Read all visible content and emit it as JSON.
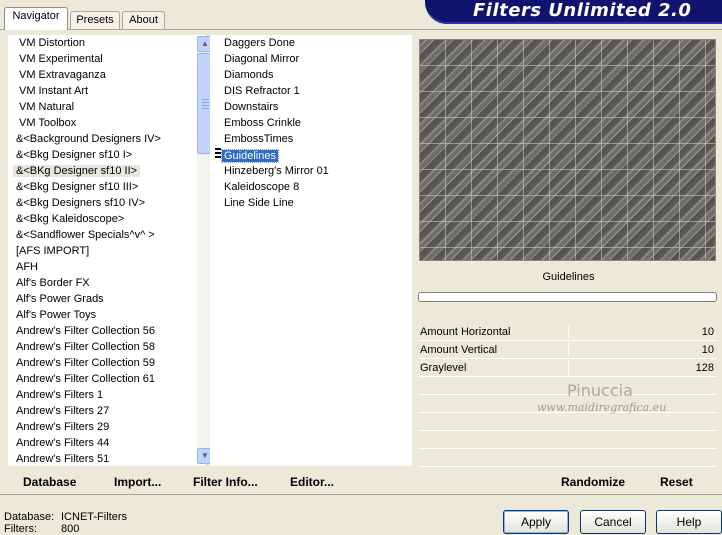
{
  "tabs": [
    {
      "label": "Navigator",
      "active": true
    },
    {
      "label": "Presets",
      "active": false
    },
    {
      "label": "About",
      "active": false
    }
  ],
  "banner": {
    "title": "Filters Unlimited 2.0"
  },
  "categories": [
    "VM Distortion",
    "VM Experimental",
    "VM Extravaganza",
    "VM Instant Art",
    "VM Natural",
    "VM Toolbox",
    "&<Background Designers IV>",
    "&<Bkg Designer sf10 I>",
    "&<BKg Designer sf10 II>",
    "&<Bkg Designer sf10 III>",
    "&<Bkg Designers sf10 IV>",
    "&<Bkg Kaleidoscope>",
    "&<Sandflower Specials^v^ >",
    "[AFS IMPORT]",
    "AFH",
    "Alf's Border FX",
    "Alf's Power Grads",
    "Alf's Power Toys",
    "Andrew's Filter Collection 56",
    "Andrew's Filter Collection 58",
    "Andrew's Filter Collection 59",
    "Andrew's Filter Collection 61",
    "Andrew's Filters 1",
    "Andrew's Filters 27",
    "Andrew's Filters 29",
    "Andrew's Filters 44",
    "Andrew's Filters 51"
  ],
  "selected_category": "&<BKg Designer sf10 II>",
  "filters": [
    "Daggers Done",
    "Diagonal Mirror",
    "Diamonds",
    "DIS Refractor 1",
    "Downstairs",
    "Emboss Crinkle",
    "EmbossTimes",
    "Guidelines",
    "Hinzeberg's Mirror 01",
    "Kaleidoscope 8",
    "Line Side Line"
  ],
  "selected_filter": "Guidelines",
  "preview": {
    "filter_name": "Guidelines"
  },
  "params": [
    {
      "label": "Amount Horizontal",
      "value": "10"
    },
    {
      "label": "Amount Vertical",
      "value": "10"
    },
    {
      "label": "Graylevel",
      "value": "128"
    }
  ],
  "watermark": {
    "name": "Pinuccia",
    "site": "www.maidiregrafica.eu"
  },
  "commands": {
    "database": "Database",
    "import": "Import...",
    "filter_info": "Filter Info...",
    "editor": "Editor...",
    "randomize": "Randomize",
    "reset": "Reset"
  },
  "status": {
    "database_label": "Database:",
    "database_value": "ICNET-Filters",
    "filters_label": "Filters:",
    "filters_value": "800"
  },
  "buttons": {
    "apply": "Apply",
    "cancel": "Cancel",
    "help": "Help"
  }
}
